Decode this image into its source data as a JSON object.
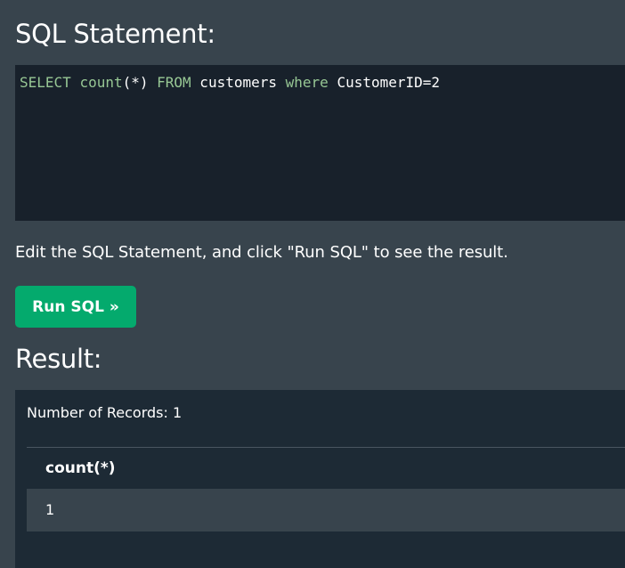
{
  "sql_heading": "SQL Statement:",
  "sql_statement": {
    "tokens": [
      {
        "text": "SELECT",
        "type": "keyword"
      },
      {
        "text": " ",
        "type": "text"
      },
      {
        "text": "count",
        "type": "keyword"
      },
      {
        "text": "(*) ",
        "type": "text"
      },
      {
        "text": "FROM",
        "type": "keyword"
      },
      {
        "text": " customers ",
        "type": "text"
      },
      {
        "text": "where",
        "type": "keyword"
      },
      {
        "text": " CustomerID=2",
        "type": "text"
      }
    ]
  },
  "hint_text": "Edit the SQL Statement, and click \"Run SQL\" to see the result.",
  "run_button_label": "Run SQL »",
  "result_heading": "Result:",
  "result": {
    "records_text": "Number of Records: 1",
    "columns": [
      "count(*)"
    ],
    "rows": [
      [
        "1"
      ]
    ]
  },
  "colors": {
    "page_bg": "#38444d",
    "code_bg": "#18212b",
    "keyword": "#97c794",
    "button_bg": "#04aa6d",
    "result_bg": "#1d2a35"
  }
}
